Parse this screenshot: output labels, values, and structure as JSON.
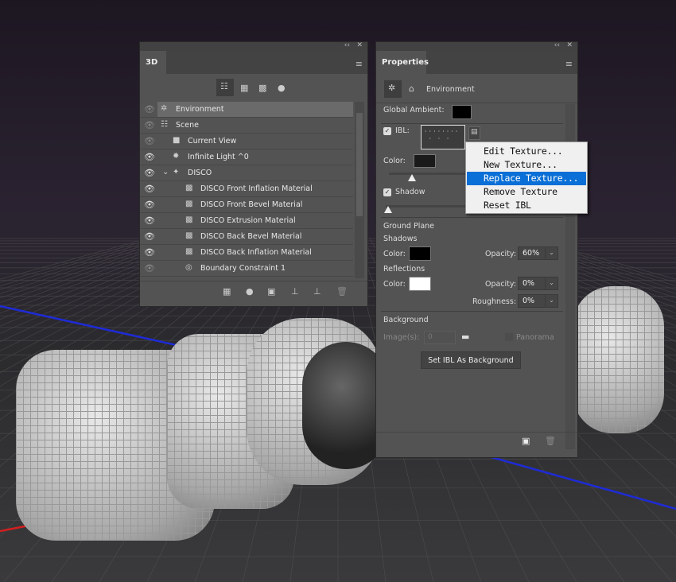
{
  "panel_3d": {
    "tab": "3D",
    "filter_icons": [
      "whole-scene-icon",
      "meshes-icon",
      "materials-icon",
      "lights-icon"
    ],
    "layers": [
      {
        "label": "Environment",
        "icon": "environment-icon",
        "visible": false,
        "selected": true,
        "indent": 0
      },
      {
        "label": "Scene",
        "icon": "scene-icon",
        "visible": false,
        "indent": 0
      },
      {
        "label": "Current View",
        "icon": "camera-icon",
        "visible": false,
        "indent": 1
      },
      {
        "label": "Infinite Light ^0",
        "icon": "light-icon",
        "visible": true,
        "indent": 1
      },
      {
        "label": "DISCO",
        "icon": "mesh-icon",
        "visible": true,
        "indent": 1,
        "expanded": true
      },
      {
        "label": "DISCO Front Inflation Material",
        "icon": "material-icon",
        "visible": true,
        "indent": 2
      },
      {
        "label": "DISCO Front Bevel Material",
        "icon": "material-icon",
        "visible": true,
        "indent": 2
      },
      {
        "label": "DISCO Extrusion Material",
        "icon": "material-icon",
        "visible": true,
        "indent": 2
      },
      {
        "label": "DISCO Back Bevel Material",
        "icon": "material-icon",
        "visible": true,
        "indent": 2
      },
      {
        "label": "DISCO Back Inflation Material",
        "icon": "material-icon",
        "visible": true,
        "indent": 2
      },
      {
        "label": "Boundary Constraint 1",
        "icon": "constraint-icon",
        "visible": false,
        "indent": 2
      }
    ]
  },
  "properties": {
    "tab": "Properties",
    "section": "Environment",
    "global_ambient_label": "Global Ambient:",
    "global_ambient_color": "#000000",
    "ibl_label": "IBL:",
    "ibl_checked": true,
    "color_label": "Color:",
    "ibl_color": "#1a1a1a",
    "shadow_label": "Shadow",
    "shadow_checked": true,
    "ground_plane": "Ground Plane",
    "shadows": "Shadows",
    "shadows_color_label": "Color:",
    "shadows_color": "#000000",
    "opacity_label": "Opacity:",
    "shadows_opacity": "60%",
    "reflections": "Reflections",
    "reflections_color_label": "Color:",
    "reflections_color": "#ffffff",
    "reflections_opacity_label": "Opacity:",
    "reflections_opacity": "0%",
    "roughness_label": "Roughness:",
    "roughness": "0%",
    "background": "Background",
    "images_label": "Image(s):",
    "images_value": "0",
    "panorama_label": "Panorama",
    "set_ibl_button": "Set IBL As Background"
  },
  "context_menu": {
    "items": [
      "Edit Texture...",
      "New Texture...",
      "Replace Texture...",
      "Remove Texture",
      "Reset IBL"
    ],
    "highlighted": "Replace Texture...",
    "highlight_color": "#0a6fd6"
  }
}
